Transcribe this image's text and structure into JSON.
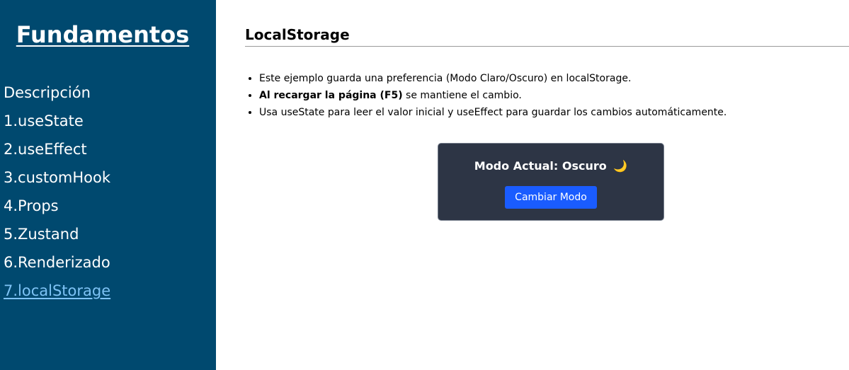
{
  "sidebar": {
    "brand": "Fundamentos",
    "items": [
      {
        "label": "Descripción"
      },
      {
        "label": "1.useState"
      },
      {
        "label": "2.useEffect"
      },
      {
        "label": "3.customHook"
      },
      {
        "label": "4.Props"
      },
      {
        "label": "5.Zustand"
      },
      {
        "label": "6.Renderizado"
      },
      {
        "label": "7.localStorage"
      }
    ],
    "active_index": 7
  },
  "main": {
    "title": "LocalStorage",
    "bullets": [
      {
        "text": "Este ejemplo guarda una preferencia (Modo Claro/Oscuro) en localStorage."
      },
      {
        "bold": "Al recargar la página (F5)",
        "text": " se mantiene el cambio."
      },
      {
        "text": "Usa useState para leer el valor inicial y useEffect para guardar los cambios automáticamente."
      }
    ],
    "card": {
      "mode_label": "Modo Actual: Oscuro",
      "mode_icon": "moon-icon",
      "mode_icon_glyph": "🌙",
      "button_label": "Cambiar Modo"
    }
  },
  "colors": {
    "sidebar_bg": "#00496f",
    "active_link": "#7ec3f5",
    "card_bg": "#2d3545",
    "button_bg": "#1a5cff"
  }
}
